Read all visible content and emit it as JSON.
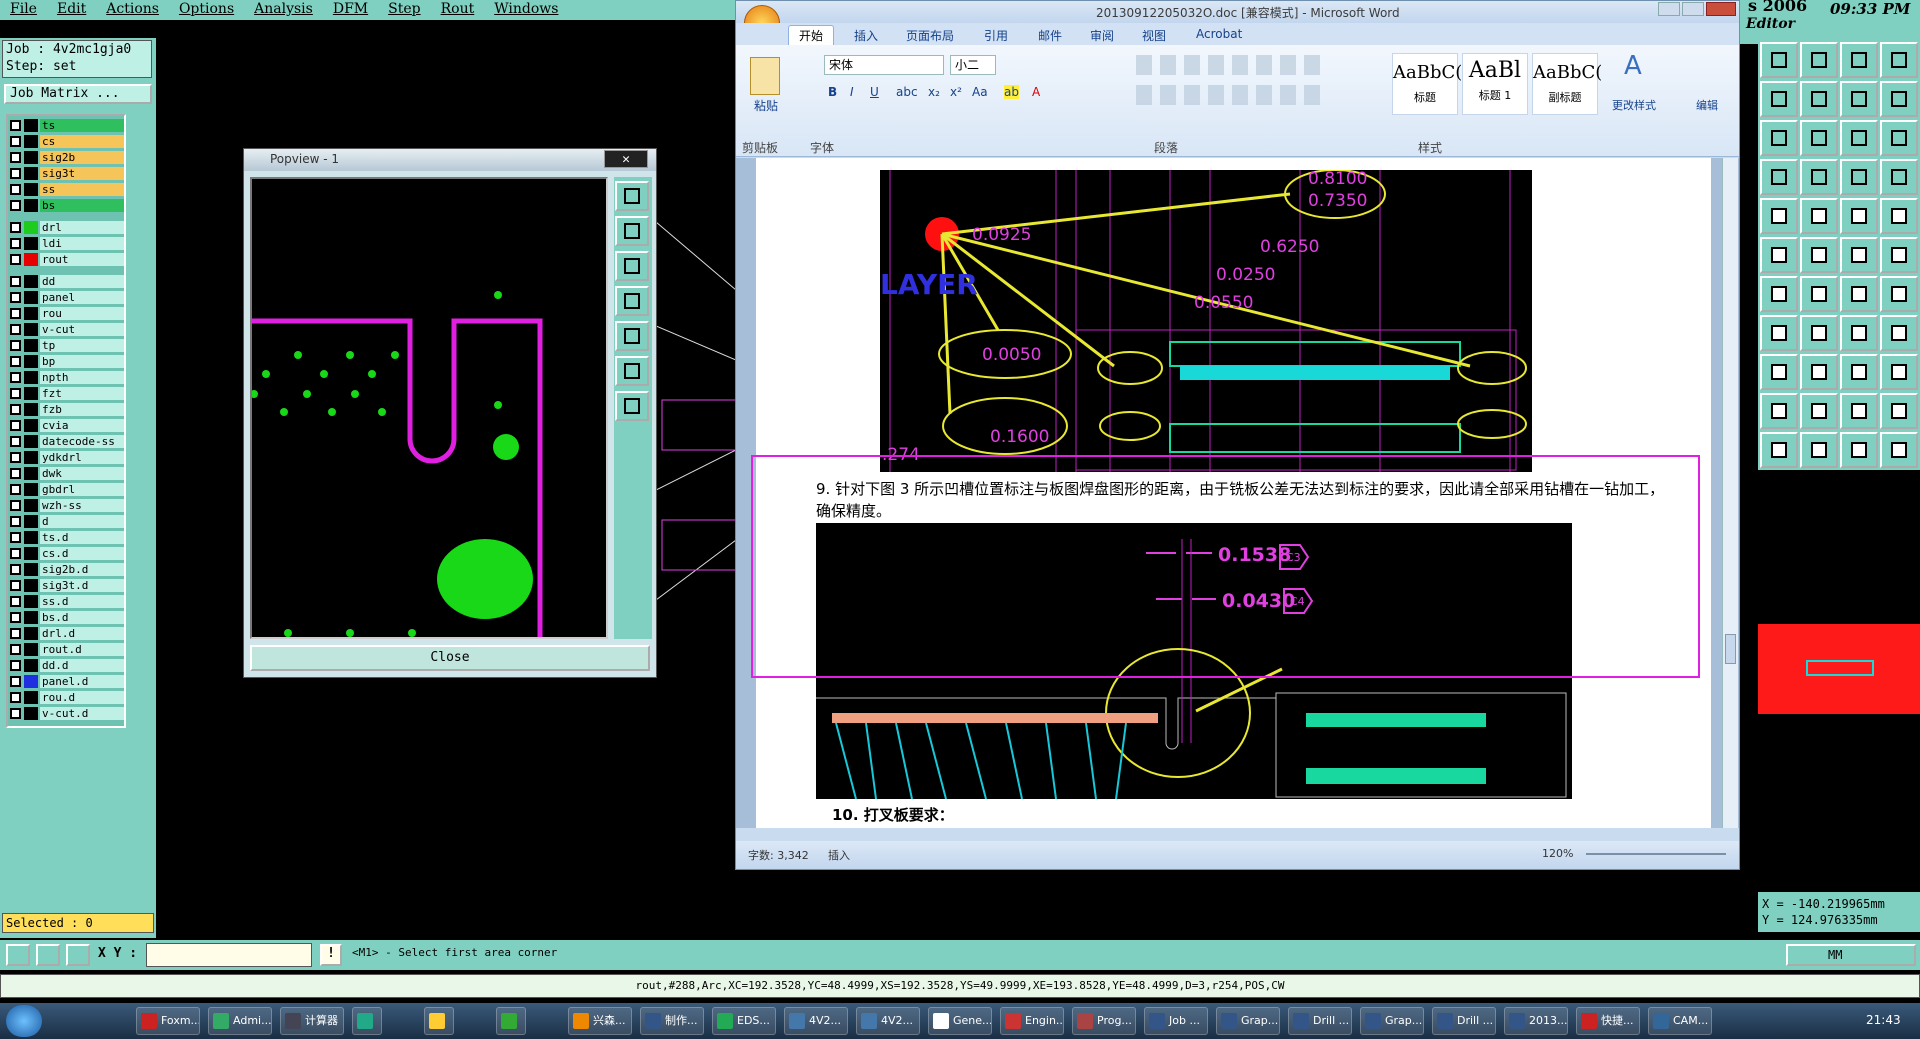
{
  "menu": [
    "File",
    "Edit",
    "Actions",
    "Options",
    "Analysis",
    "DFM",
    "Step",
    "Rout",
    "Windows"
  ],
  "job": {
    "job": "Job : 4v2mc1gja0",
    "step": "Step: set",
    "matrix_btn": "Job Matrix ..."
  },
  "layers": [
    {
      "name": "ts",
      "sw": "#000",
      "bg": "#2fbf5f"
    },
    {
      "name": "cs",
      "sw": "#000",
      "bg": "#f6c55a"
    },
    {
      "name": "sig2b",
      "sw": "#000",
      "bg": "#f6c55a"
    },
    {
      "name": "sig3t",
      "sw": "#000",
      "bg": "#f6c55a"
    },
    {
      "name": "ss",
      "sw": "#000",
      "bg": "#f6c55a"
    },
    {
      "name": "bs",
      "sw": "#000",
      "bg": "#2fbf5f"
    },
    {
      "name": "drl",
      "sw": "#1ecc1e",
      "bg": "#bff0e6"
    },
    {
      "name": "ldi",
      "sw": "#000",
      "bg": "#bff0e6"
    },
    {
      "name": "rout",
      "sw": "#e60000",
      "bg": "#bff0e6"
    },
    {
      "name": "dd",
      "sw": "#000",
      "bg": "#bff0e6"
    },
    {
      "name": "panel",
      "sw": "#000",
      "bg": "#bff0e6"
    },
    {
      "name": "rou",
      "sw": "#000",
      "bg": "#bff0e6"
    },
    {
      "name": "v-cut",
      "sw": "#000",
      "bg": "#bff0e6"
    },
    {
      "name": "tp",
      "sw": "#000",
      "bg": "#bff0e6"
    },
    {
      "name": "bp",
      "sw": "#000",
      "bg": "#bff0e6"
    },
    {
      "name": "npth",
      "sw": "#000",
      "bg": "#bff0e6"
    },
    {
      "name": "fzt",
      "sw": "#000",
      "bg": "#bff0e6"
    },
    {
      "name": "fzb",
      "sw": "#000",
      "bg": "#bff0e6"
    },
    {
      "name": "cvia",
      "sw": "#000",
      "bg": "#bff0e6"
    },
    {
      "name": "datecode-ss",
      "sw": "#000",
      "bg": "#bff0e6"
    },
    {
      "name": "ydkdrl",
      "sw": "#000",
      "bg": "#bff0e6"
    },
    {
      "name": "dwk",
      "sw": "#000",
      "bg": "#bff0e6"
    },
    {
      "name": "gbdrl",
      "sw": "#000",
      "bg": "#bff0e6"
    },
    {
      "name": "wzh-ss",
      "sw": "#000",
      "bg": "#bff0e6"
    },
    {
      "name": "d",
      "sw": "#000",
      "bg": "#bff0e6"
    },
    {
      "name": "ts.d",
      "sw": "#000",
      "bg": "#bff0e6"
    },
    {
      "name": "cs.d",
      "sw": "#000",
      "bg": "#bff0e6"
    },
    {
      "name": "sig2b.d",
      "sw": "#000",
      "bg": "#bff0e6"
    },
    {
      "name": "sig3t.d",
      "sw": "#000",
      "bg": "#bff0e6"
    },
    {
      "name": "ss.d",
      "sw": "#000",
      "bg": "#bff0e6"
    },
    {
      "name": "bs.d",
      "sw": "#000",
      "bg": "#bff0e6"
    },
    {
      "name": "drl.d",
      "sw": "#000",
      "bg": "#bff0e6"
    },
    {
      "name": "rout.d",
      "sw": "#000",
      "bg": "#bff0e6"
    },
    {
      "name": "dd.d",
      "sw": "#000",
      "bg": "#bff0e6"
    },
    {
      "name": "panel.d",
      "sw": "#2030e0",
      "bg": "#bff0e6"
    },
    {
      "name": "rou.d",
      "sw": "#000",
      "bg": "#bff0e6"
    },
    {
      "name": "v-cut.d",
      "sw": "#000",
      "bg": "#bff0e6"
    }
  ],
  "selected": "Selected : 0",
  "bottom": {
    "xy_label": "X Y :",
    "prompt": "<M1> - Select first area corner",
    "unit": "MM"
  },
  "status_line": "rout,#288,Arc,XC=192.3528,YC=48.4999,XS=192.3528,YS=49.9999,XE=193.8528,YE=48.4999,D=3,r254,POS,CW",
  "clock_top": "09:33 PM",
  "editor_label": "Editor",
  "version": "s 2006",
  "coords": {
    "x": "X = -140.219965mm",
    "y": "Y = 124.976335mm"
  },
  "popview": {
    "title": "Popview - 1",
    "close": "Close"
  },
  "word": {
    "title": "20130912205032O.doc [兼容模式] - Microsoft Word",
    "tabs": [
      "开始",
      "插入",
      "页面布局",
      "引用",
      "邮件",
      "审阅",
      "视图",
      "Acrobat"
    ],
    "font_name": "宋体",
    "font_size": "小二",
    "groups": [
      "剪贴板",
      "字体",
      "段落",
      "样式"
    ],
    "paste": "粘贴",
    "change_styles": "更改样式",
    "edit": "编辑",
    "styles": [
      {
        "preview": "AaBbC(",
        "name": "标题"
      },
      {
        "preview": "AaBl",
        "name": "标题 1"
      },
      {
        "preview": "AaBbC(",
        "name": "副标题"
      }
    ],
    "para9": "9. 针对下图 3 所示凹槽位置标注与板图焊盘图形的距离，由于铣板公差无法达到标注的要求，因此请全部采用钻槽在一钻加工，确保精度。",
    "para10": "10. 打叉板要求：",
    "dims_top": [
      "0.8100",
      "0.7350",
      "0.0925",
      "0.6250",
      "0.0250",
      "0.0550",
      "0.0050",
      "0.1600",
      ".274"
    ],
    "layer_text": "LAYER",
    "dims_mid": [
      "0.1538",
      "0.0430"
    ],
    "dim_tags": [
      "C3",
      "C4"
    ],
    "status_words": "字数: 3,342",
    "status_insert": "插入",
    "zoom": "120%"
  },
  "taskbar": {
    "items": [
      "Foxm...",
      "Admi...",
      "计算器",
      "",
      "",
      "",
      "兴森...",
      "制作...",
      "EDS...",
      "4V2...",
      "4V2...",
      "Gene...",
      "Engin...",
      "Prog...",
      "Job ...",
      "Grap...",
      "Drill ...",
      "Grap...",
      "Drill ...",
      "2013...",
      "快捷...",
      "CAM..."
    ],
    "time": "21:43"
  }
}
